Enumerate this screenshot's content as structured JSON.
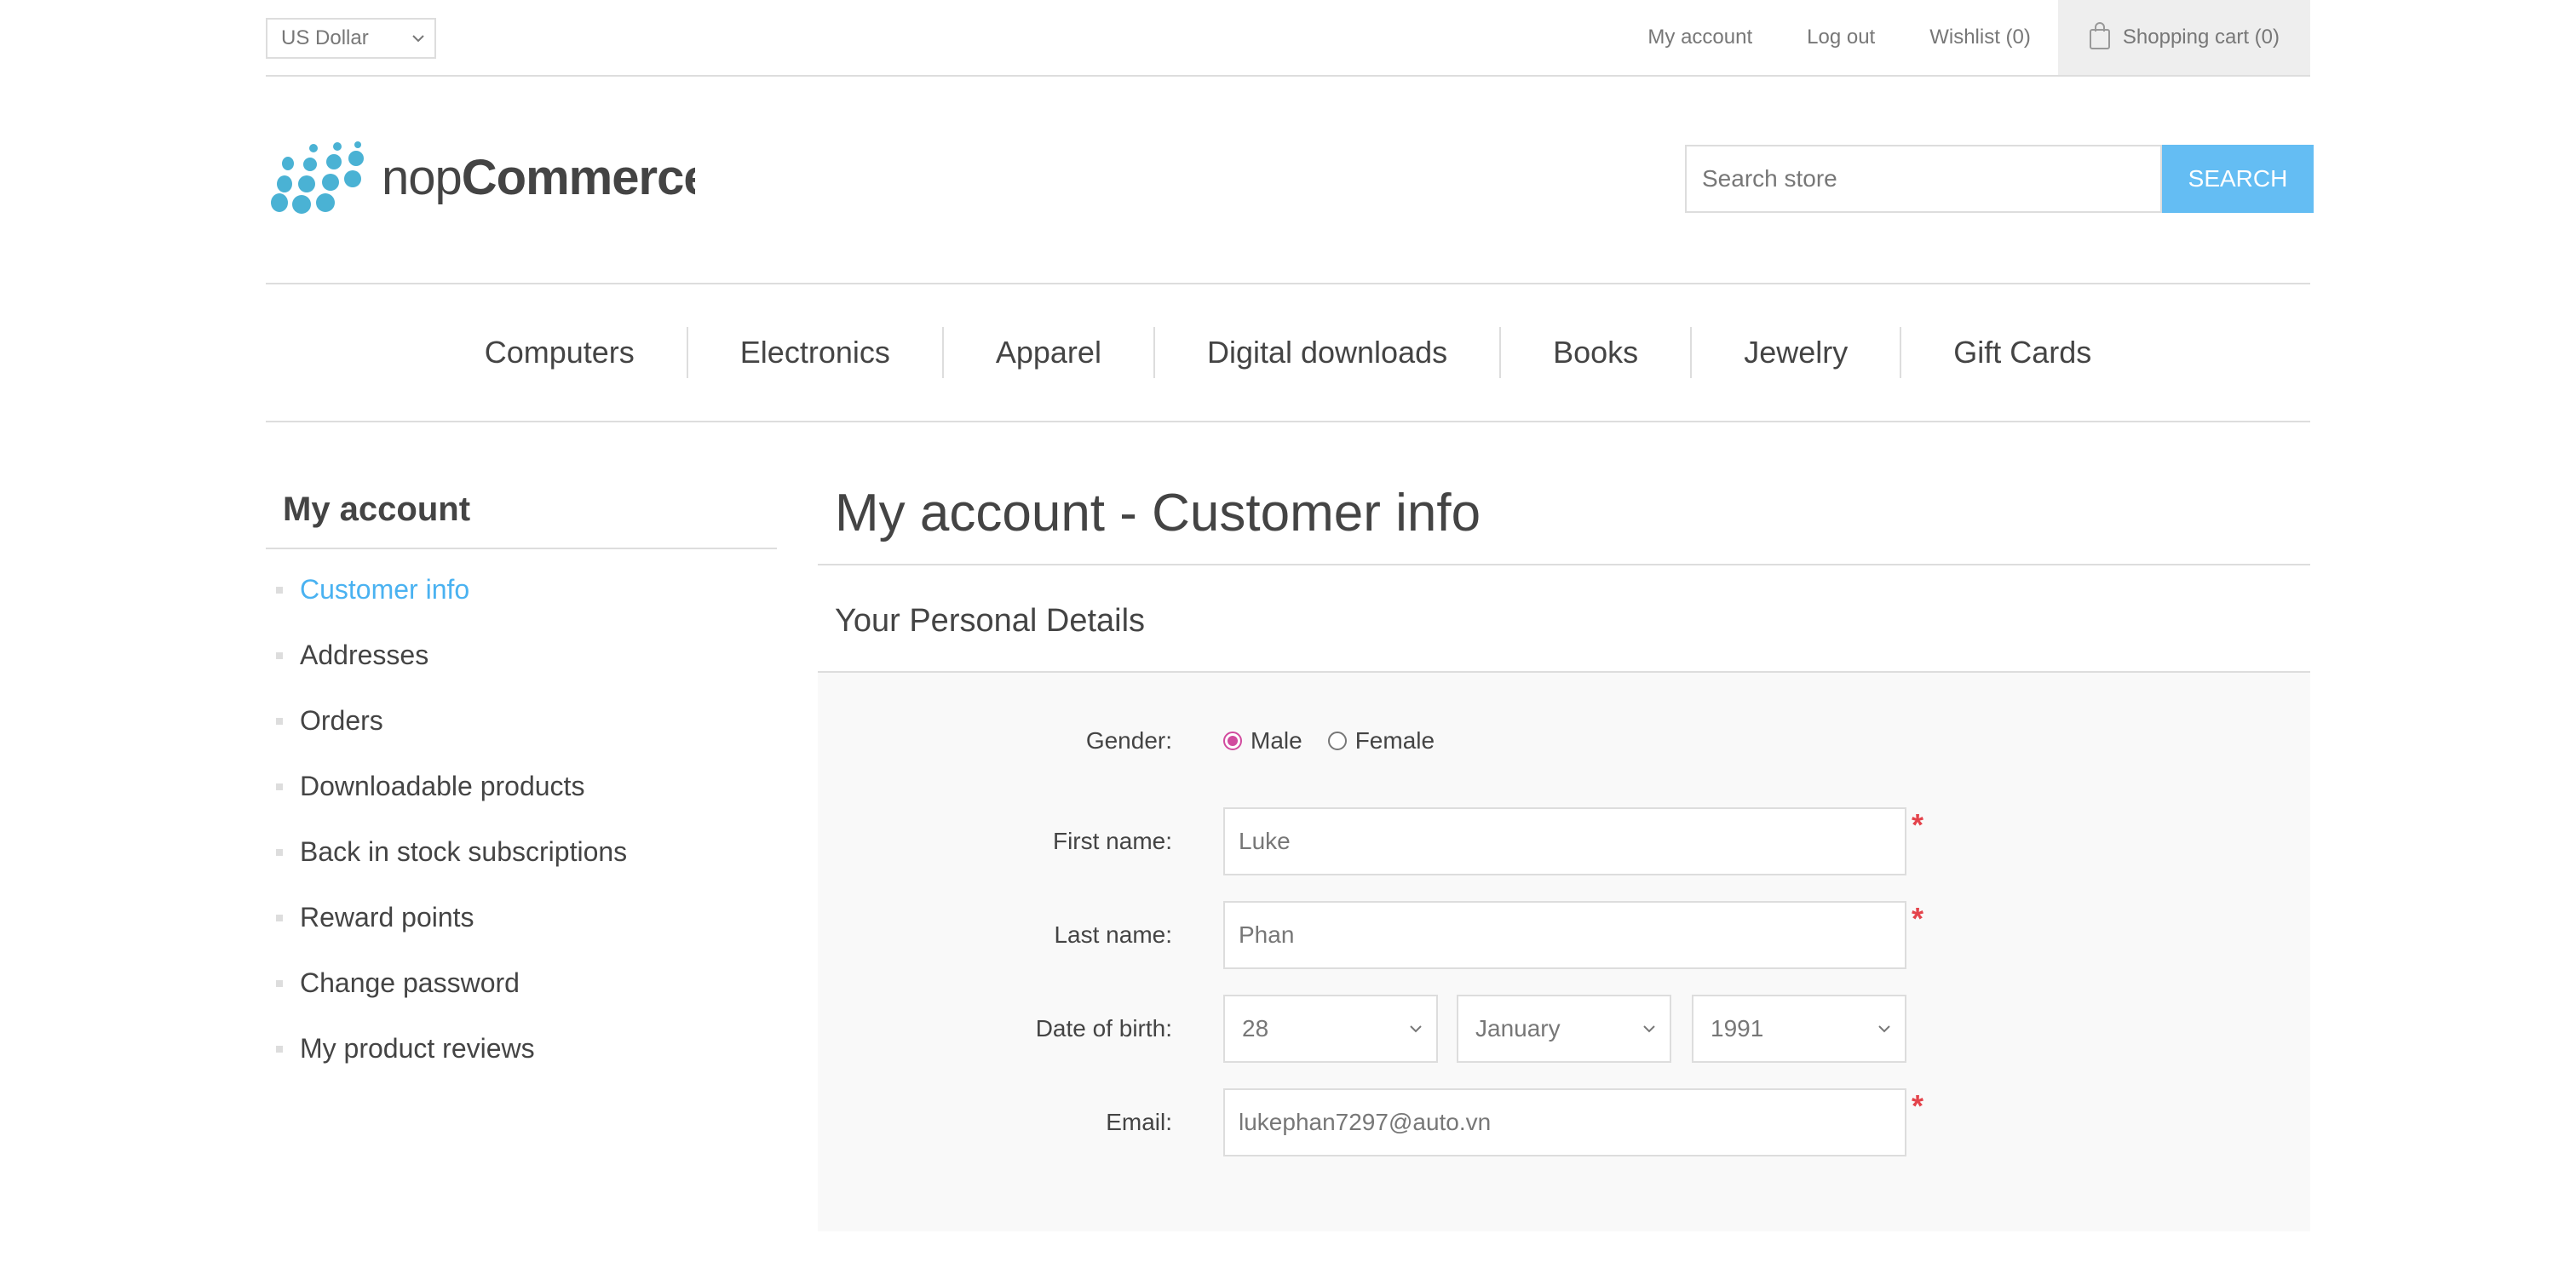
{
  "header": {
    "currency": "US Dollar",
    "links": {
      "my_account": "My account",
      "log_out": "Log out",
      "wishlist": "Wishlist (0)",
      "shopping_cart": "Shopping cart (0)"
    }
  },
  "logo": {
    "text_light": "nop",
    "text_bold": "Commerce",
    "colors": {
      "dots": "#4ab2d4",
      "text": "#444444"
    }
  },
  "search": {
    "placeholder": "Search store",
    "button_label": "SEARCH"
  },
  "menu": [
    "Computers",
    "Electronics",
    "Apparel",
    "Digital downloads",
    "Books",
    "Jewelry",
    "Gift Cards"
  ],
  "sidebar": {
    "title": "My account",
    "items": [
      {
        "label": "Customer info",
        "active": true
      },
      {
        "label": "Addresses"
      },
      {
        "label": "Orders"
      },
      {
        "label": "Downloadable products"
      },
      {
        "label": "Back in stock subscriptions"
      },
      {
        "label": "Reward points"
      },
      {
        "label": "Change password"
      },
      {
        "label": "My product reviews"
      }
    ]
  },
  "main": {
    "page_title": "My account - Customer info",
    "section_title": "Your Personal Details",
    "form": {
      "gender": {
        "label": "Gender:",
        "options": [
          "Male",
          "Female"
        ],
        "selected": "Male"
      },
      "first_name": {
        "label": "First name:",
        "value": "Luke"
      },
      "last_name": {
        "label": "Last name:",
        "value": "Phan"
      },
      "dob": {
        "label": "Date of birth:",
        "day": "28",
        "month": "January",
        "year": "1991"
      },
      "email": {
        "label": "Email:",
        "value": "lukephan7297@auto.vn"
      },
      "required_mark": "*"
    }
  },
  "colors": {
    "accent": "#4ab2f1",
    "required": "#e4434b",
    "radio_checked": "#d14b9e"
  }
}
